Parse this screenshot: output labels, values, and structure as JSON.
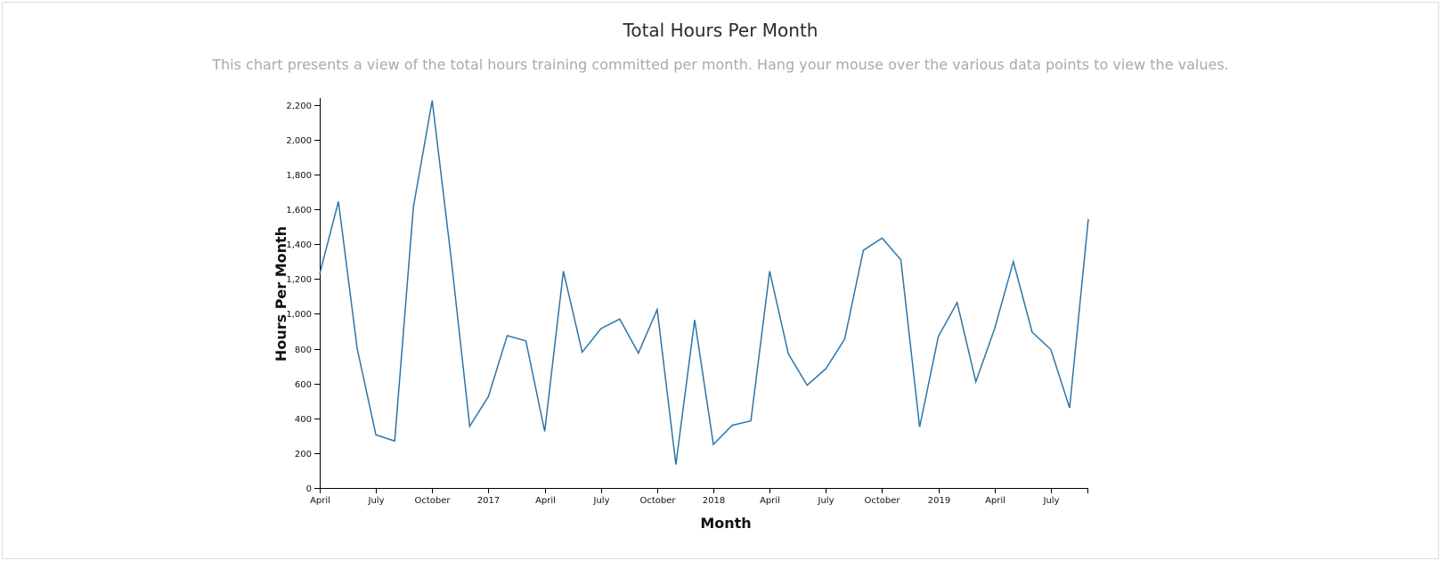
{
  "chart_data": {
    "type": "line",
    "title": "Total Hours Per Month",
    "subtitle": "This chart presents a view of the total hours training committed per month. Hang your mouse over the various data points to view the values.",
    "xlabel": "Month",
    "ylabel": "Hours Per Month",
    "ylim": [
      0,
      2240
    ],
    "yticks": [
      0,
      200,
      400,
      600,
      800,
      1000,
      1200,
      1400,
      1600,
      1800,
      2000,
      2200
    ],
    "ytick_labels": [
      "0",
      "200",
      "400",
      "600",
      "800",
      "1,000",
      "1,200",
      "1,400",
      "1,600",
      "1,800",
      "2,000",
      "2,200"
    ],
    "xlim": [
      "2016-04",
      "2019-09"
    ],
    "xtick_labels": [
      {
        "month": "2016-04",
        "label": "April"
      },
      {
        "month": "2016-07",
        "label": "July"
      },
      {
        "month": "2016-10",
        "label": "October"
      },
      {
        "month": "2017-01",
        "label": "2017"
      },
      {
        "month": "2017-04",
        "label": "April"
      },
      {
        "month": "2017-07",
        "label": "July"
      },
      {
        "month": "2017-10",
        "label": "October"
      },
      {
        "month": "2018-01",
        "label": "2018"
      },
      {
        "month": "2018-04",
        "label": "April"
      },
      {
        "month": "2018-07",
        "label": "July"
      },
      {
        "month": "2018-10",
        "label": "October"
      },
      {
        "month": "2019-01",
        "label": "2019"
      },
      {
        "month": "2019-04",
        "label": "April"
      },
      {
        "month": "2019-07",
        "label": "July"
      }
    ],
    "grid": false,
    "line_color": "#2d75a8",
    "series": [
      {
        "x": [
          "2016-04",
          "2016-05",
          "2016-06",
          "2016-07",
          "2016-08",
          "2016-09",
          "2016-10",
          "2016-11",
          "2016-12",
          "2017-01",
          "2017-02",
          "2017-03",
          "2017-04",
          "2017-05",
          "2017-06",
          "2017-07",
          "2017-08",
          "2017-09",
          "2017-10",
          "2017-11",
          "2017-12",
          "2018-01",
          "2018-02",
          "2018-03",
          "2018-04",
          "2018-05",
          "2018-06",
          "2018-07",
          "2018-08",
          "2018-09",
          "2018-10",
          "2018-11",
          "2018-12",
          "2019-01",
          "2019-02",
          "2019-03",
          "2019-04",
          "2019-05",
          "2019-06",
          "2019-07",
          "2019-08",
          "2019-09"
        ],
        "values": [
          1230,
          1645,
          800,
          305,
          270,
          1615,
          2225,
          1330,
          355,
          525,
          875,
          845,
          325,
          1245,
          780,
          915,
          970,
          775,
          1025,
          135,
          965,
          250,
          360,
          385,
          1245,
          770,
          590,
          685,
          855,
          1365,
          1435,
          1310,
          350,
          870,
          1065,
          610,
          915,
          1300,
          895,
          795,
          460,
          1545
        ]
      }
    ]
  }
}
